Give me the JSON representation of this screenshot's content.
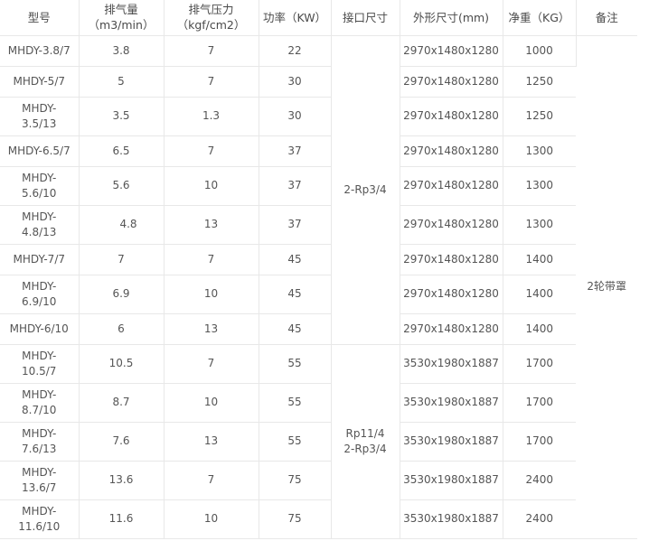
{
  "table": {
    "headers": {
      "model": "型号",
      "flow_line1": "排气量",
      "flow_line2": "（m3/min）",
      "pressure_line1": "排气压力",
      "pressure_line2": "（kgf/cm2）",
      "power": "功率（KW）",
      "port": "接口尺寸",
      "dimensions": "外形尺寸(mm)",
      "weight": "净重（KG）",
      "note": "备注"
    },
    "rows": [
      {
        "model_a": "MHDY-3.8/7",
        "model_b": "",
        "flow": "3.8",
        "pressure": "7",
        "power": "22",
        "dimensions": "2970x1480x1280",
        "weight": "1000"
      },
      {
        "model_a": "MHDY-5/7",
        "model_b": "",
        "flow": "5",
        "pressure": "7",
        "power": "30",
        "dimensions": "2970x1480x1280",
        "weight": "1250"
      },
      {
        "model_a": "MHDY-",
        "model_b": "3.5/13",
        "flow": "3.5",
        "pressure": "1.3",
        "power": "30",
        "dimensions": "2970x1480x1280",
        "weight": "1250"
      },
      {
        "model_a": "MHDY-6.5/7",
        "model_b": "",
        "flow": "6.5",
        "pressure": "7",
        "power": "37",
        "dimensions": "2970x1480x1280",
        "weight": "1300"
      },
      {
        "model_a": "MHDY-",
        "model_b": "5.6/10",
        "flow": "5.6",
        "pressure": "10",
        "power": "37",
        "dimensions": "2970x1480x1280",
        "weight": "1300"
      },
      {
        "model_a": "MHDY-",
        "model_b": "4.8/13",
        "flow": "4.8",
        "pressure": "13",
        "power": "37",
        "dimensions": "2970x1480x1280",
        "weight": "1300"
      },
      {
        "model_a": "MHDY-7/7",
        "model_b": "",
        "flow": "7",
        "pressure": "7",
        "power": "45",
        "dimensions": "2970x1480x1280",
        "weight": "1400"
      },
      {
        "model_a": "MHDY-",
        "model_b": "6.9/10",
        "flow": "6.9",
        "pressure": "10",
        "power": "45",
        "dimensions": "2970x1480x1280",
        "weight": "1400"
      },
      {
        "model_a": "MHDY-6/10",
        "model_b": "",
        "flow": "6",
        "pressure": "13",
        "power": "45",
        "dimensions": "2970x1480x1280",
        "weight": "1400"
      },
      {
        "model_a": "MHDY-",
        "model_b": "10.5/7",
        "flow": "10.5",
        "pressure": "7",
        "power": "55",
        "dimensions": "3530x1980x1887",
        "weight": "1700"
      },
      {
        "model_a": "MHDY-",
        "model_b": "8.7/10",
        "flow": "8.7",
        "pressure": "10",
        "power": "55",
        "dimensions": "3530x1980x1887",
        "weight": "1700"
      },
      {
        "model_a": "MHDY-",
        "model_b": "7.6/13",
        "flow": "7.6",
        "pressure": "13",
        "power": "55",
        "dimensions": "3530x1980x1887",
        "weight": "1700"
      },
      {
        "model_a": "MHDY-",
        "model_b": "13.6/7",
        "flow": "13.6",
        "pressure": "7",
        "power": "75",
        "dimensions": "3530x1980x1887",
        "weight": "2400"
      },
      {
        "model_a": "MHDY-",
        "model_b": "11.6/10",
        "flow": "11.6",
        "pressure": "10",
        "power": "75",
        "dimensions": "3530x1980x1887",
        "weight": "2400"
      }
    ],
    "port_groups": {
      "group1": "2-Rp3/4",
      "group2_line1": "Rp11/4",
      "group2_line2": "2-Rp3/4"
    },
    "note_value": "2轮带罩"
  }
}
